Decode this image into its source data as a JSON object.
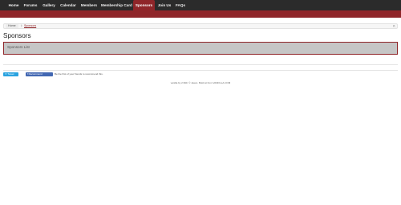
{
  "nav": {
    "tabs": [
      {
        "label": "Home"
      },
      {
        "label": "Forums"
      },
      {
        "label": "Gallery"
      },
      {
        "label": "Calendar"
      },
      {
        "label": "Members"
      },
      {
        "label": "Membership Card"
      },
      {
        "label": "Sponsors",
        "active": true
      },
      {
        "label": "Join Us"
      },
      {
        "label": "FAQs"
      }
    ]
  },
  "breadcrumb": {
    "home": "Home",
    "current": "Sponsors"
  },
  "page": {
    "title": "Sponsors",
    "list_label": "Sponsors List"
  },
  "social": {
    "tweet_label": "Tweet",
    "recommend_label": "Recommend",
    "recommend_text": "Be the first of your friends to recommend this."
  },
  "footer": {
    "text": "vanilla by 2.990. © Jason. Bold.ist from VANFILLA.COM"
  },
  "colors": {
    "accent": "#8f2529",
    "navbar": "#2b2b2b",
    "twitter": "#2aa3e0",
    "facebook": "#4267b2"
  }
}
